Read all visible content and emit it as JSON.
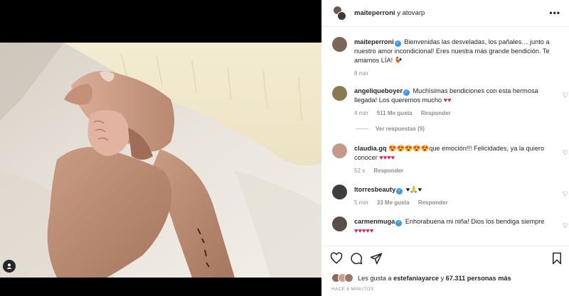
{
  "header": {
    "user": "maiteperroni",
    "connector": "y",
    "coauthor": "atovarp"
  },
  "caption": {
    "user": "maiteperroni",
    "text": "Bienvenidas las desveladas, los pañales… junto a nuestro amor incondicional! Eres nuestra más grande bendición. Te amamos LÍA! 🐓",
    "time": "8 min"
  },
  "comments": [
    {
      "user": "angeliqueboyer",
      "verified": true,
      "text": "Muchísimas bendiciones con esta hermosa llegada! Los queremos mucho",
      "emoji": "♥♥",
      "time": "4 min",
      "likes": "511 Me gusta",
      "reply": "Responder"
    },
    {
      "user": "claudia.gq",
      "verified": false,
      "text_pre": "😍😍😍😍😍",
      "text": "que emoción!!! Felicidades, ya la quiero conocer",
      "emoji": "♥♥♥♥",
      "time": "52 s",
      "reply": "Responder"
    },
    {
      "user": "ltorresbeauty",
      "verified": true,
      "text": "♥🙏♥",
      "time": "5 min",
      "likes": "33 Me gusta",
      "reply": "Responder"
    },
    {
      "user": "carmenmuga",
      "verified": true,
      "text": "Enhorabuena mi niña! Dios los bendiga siempre",
      "emoji": "♥♥♥♥♥"
    }
  ],
  "view_replies": "Ver respuestas (5)",
  "likes": {
    "prefix": "Les gusta a",
    "user": "estefaniayarce",
    "middle": "y",
    "count": "67.311 personas más"
  },
  "timestamp": "HACE 8 MINUTOS",
  "icons": [
    "user-tag-icon",
    "more-options-icon",
    "verified-icon",
    "heart-icon",
    "comment-icon",
    "share-icon",
    "bookmark-icon"
  ],
  "colors": {
    "verified": "#3897f0",
    "heart_emoji": "#e0245e",
    "muted_text": "#8e8e8e"
  }
}
